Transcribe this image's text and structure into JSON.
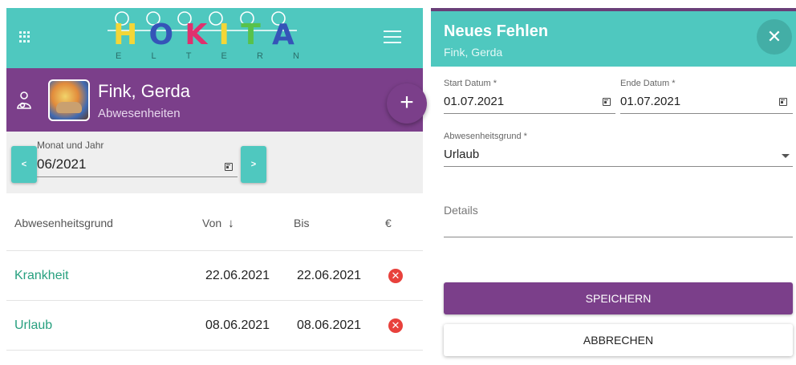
{
  "app": {
    "logo_letters": [
      "H",
      "O",
      "K",
      "I",
      "T",
      "A"
    ],
    "logo_sub": [
      "E",
      "L",
      "T",
      "E",
      "R",
      "N"
    ],
    "logo_colors": [
      "#f4d637",
      "#3554b8",
      "#e0306e",
      "#f4d637",
      "#58c24a",
      "#3554b8"
    ],
    "accent_teal": "#4fc8bf",
    "accent_purple": "#7b3f8a",
    "grid_icon": "apps-grid-icon",
    "menu_icon": "hamburger-menu-icon"
  },
  "profile": {
    "name": "Fink, Gerda",
    "section": "Abwesenheiten",
    "child_icon": "child-icon",
    "add_label": "+"
  },
  "filter": {
    "label": "Monat und Jahr",
    "value": "06/2021",
    "prev_label": "<",
    "next_label": ">"
  },
  "table": {
    "headers": {
      "grund": "Abwesenheitsgrund",
      "von": "Von",
      "von_sort": "↓",
      "bis": "Bis",
      "eur": "€"
    },
    "rows": [
      {
        "grund": "Krankheit",
        "von": "22.06.2021",
        "bis": "22.06.2021",
        "delete": "✕"
      },
      {
        "grund": "Urlaub",
        "von": "08.06.2021",
        "bis": "08.06.2021",
        "delete": "✕"
      }
    ]
  },
  "dialog": {
    "title": "Neues Fehlen",
    "subtitle": "Fink, Gerda",
    "close_label": "✕",
    "start_label": "Start Datum *",
    "start_value": "01.07.2021",
    "end_label": "Ende Datum *",
    "end_value": "01.07.2021",
    "grund_label": "Abwesenheitsgrund *",
    "grund_value": "Urlaub",
    "details_label": "Details",
    "save_label": "SPEICHERN",
    "cancel_label": "ABBRECHEN"
  }
}
